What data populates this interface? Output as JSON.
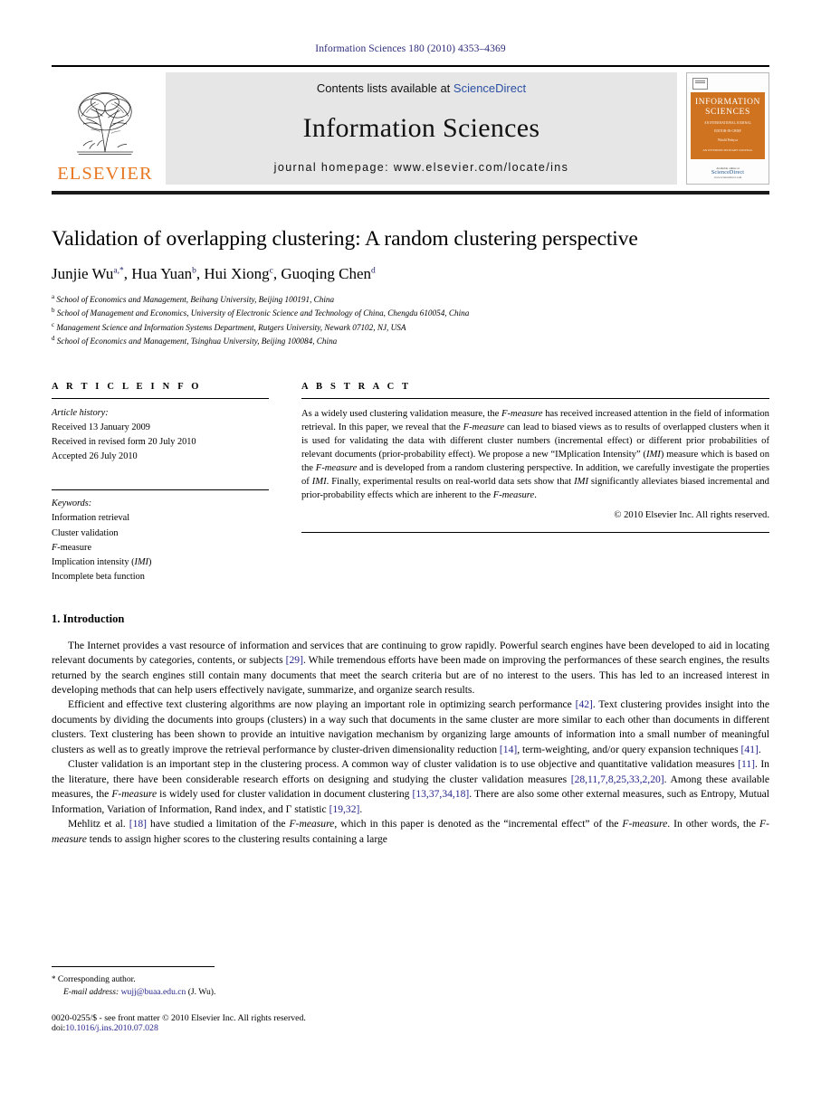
{
  "running_head": "Information Sciences 180 (2010) 4353–4369",
  "masthead": {
    "contents_prefix": "Contents lists available at ",
    "sciencedirect": "ScienceDirect",
    "journal_name": "Information Sciences",
    "homepage": "journal homepage: www.elsevier.com/locate/ins",
    "publisher": "ELSEVIER",
    "cover": {
      "title_line1": "INFORMATION",
      "title_line2": "SCIENCES",
      "sub1": "AN INTERNATIONAL JOURNAL",
      "sub2": "EDITOR-IN-CHIEF",
      "sub3": "Witold Pedrycz",
      "sub4": "AN INTERDISCIPLINARY JOURNAL",
      "foot1": "Available online at",
      "foot2": "ScienceDirect",
      "foot3": "www.sciencedirect.com"
    },
    "colors": {
      "elsevier_orange": "#e87722",
      "link_blue": "#2b4fa2",
      "cover_orange": "#cf7321"
    }
  },
  "article": {
    "title": "Validation of overlapping clustering: A random clustering perspective",
    "authors": [
      {
        "name": "Junjie Wu",
        "marks": "a,*"
      },
      {
        "name": "Hua Yuan",
        "marks": "b"
      },
      {
        "name": "Hui Xiong",
        "marks": "c"
      },
      {
        "name": "Guoqing Chen",
        "marks": "d"
      }
    ],
    "affiliations": [
      {
        "mark": "a",
        "text": "School of Economics and Management, Beihang University, Beijing 100191, China"
      },
      {
        "mark": "b",
        "text": "School of Management and Economics, University of Electronic Science and Technology of China, Chengdu 610054, China"
      },
      {
        "mark": "c",
        "text": "Management Science and Information Systems Department, Rutgers University, Newark 07102, NJ, USA"
      },
      {
        "mark": "d",
        "text": "School of Economics and Management, Tsinghua University, Beijing 100084, China"
      }
    ]
  },
  "article_info": {
    "heading": "A R T I C L E   I N F O",
    "history_label": "Article history:",
    "history": [
      "Received 13 January 2009",
      "Received in revised form 20 July 2010",
      "Accepted 26 July 2010"
    ],
    "keywords_label": "Keywords:",
    "keywords": [
      "Information retrieval",
      "Cluster validation",
      "F-measure",
      "Implication intensity (IMI)",
      "Incomplete beta function"
    ]
  },
  "abstract": {
    "heading": "A B S T R A C T",
    "text": "As a widely used clustering validation measure, the F-measure has received increased attention in the field of information retrieval. In this paper, we reveal that the F-measure can lead to biased views as to results of overlapped clusters when it is used for validating the data with different cluster numbers (incremental effect) or different prior probabilities of relevant documents (prior-probability effect). We propose a new “IMplication Intensity” (IMI) measure which is based on the F-measure and is developed from a random clustering perspective. In addition, we carefully investigate the properties of IMI. Finally, experimental results on real-world data sets show that IMI significantly alleviates biased incremental and prior-probability effects which are inherent to the F-measure.",
    "copyright": "© 2010 Elsevier Inc. All rights reserved."
  },
  "body": {
    "section_heading": "1. Introduction",
    "paragraphs": [
      "The Internet provides a vast resource of information and services that are continuing to grow rapidly. Powerful search engines have been developed to aid in locating relevant documents by categories, contents, or subjects [29]. While tremendous efforts have been made on improving the performances of these search engines, the results returned by the search engines still contain many documents that meet the search criteria but are of no interest to the users. This has led to an increased interest in developing methods that can help users effectively navigate, summarize, and organize search results.",
      "Efficient and effective text clustering algorithms are now playing an important role in optimizing search performance [42]. Text clustering provides insight into the documents by dividing the documents into groups (clusters) in a way such that documents in the same cluster are more similar to each other than documents in different clusters. Text clustering has been shown to provide an intuitive navigation mechanism by organizing large amounts of information into a small number of meaningful clusters as well as to greatly improve the retrieval performance by cluster-driven dimensionality reduction [14], term-weighting, and/or query expansion techniques [41].",
      "Cluster validation is an important step in the clustering process. A common way of cluster validation is to use objective and quantitative validation measures [11]. In the literature, there have been considerable research efforts on designing and studying the cluster validation measures [28,11,7,8,25,33,2,20]. Among these available measures, the F-measure is widely used for cluster validation in document clustering [13,37,34,18]. There are also some other external measures, such as Entropy, Mutual Information, Variation of Information, Rand index, and Γ statistic [19,32].",
      "Mehlitz et al. [18] have studied a limitation of the F-measure, which in this paper is denoted as the “incremental effect” of the F-measure. In other words, the F-measure tends to assign higher scores to the clustering results containing a large"
    ]
  },
  "footnotes": {
    "corresponding_marker": "*",
    "corresponding_label": "Corresponding author.",
    "email_label": "E-mail address:",
    "email": "wujj@buaa.edu.cn",
    "email_owner": "(J. Wu).",
    "issn_line": "0020-0255/$ - see front matter © 2010 Elsevier Inc. All rights reserved.",
    "doi_label": "doi:",
    "doi": "10.1016/j.ins.2010.07.028"
  }
}
